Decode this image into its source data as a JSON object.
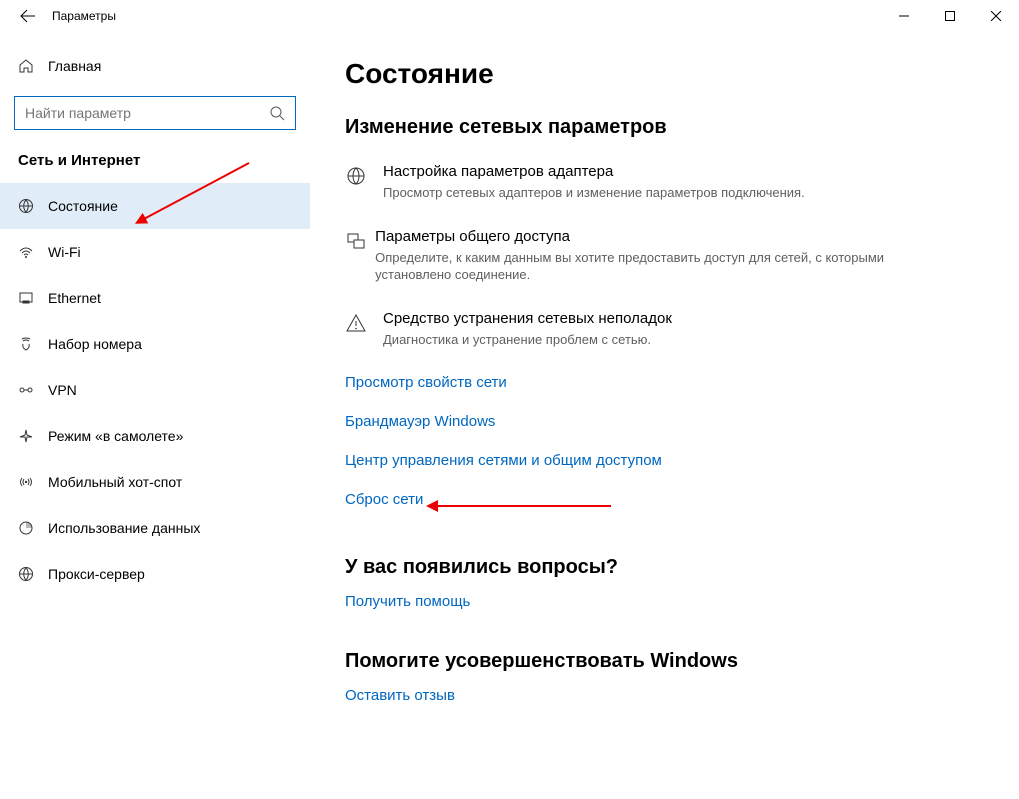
{
  "window": {
    "title": "Параметры"
  },
  "sidebar": {
    "home": "Главная",
    "search_placeholder": "Найти параметр",
    "section": "Сеть и Интернет",
    "items": [
      {
        "label": "Состояние"
      },
      {
        "label": "Wi-Fi"
      },
      {
        "label": "Ethernet"
      },
      {
        "label": "Набор номера"
      },
      {
        "label": "VPN"
      },
      {
        "label": "Режим «в самолете»"
      },
      {
        "label": "Мобильный хот-спот"
      },
      {
        "label": "Использование данных"
      },
      {
        "label": "Прокси-сервер"
      }
    ]
  },
  "main": {
    "title": "Состояние",
    "change_title": "Изменение сетевых параметров",
    "options": [
      {
        "title": "Настройка параметров адаптера",
        "desc": "Просмотр сетевых адаптеров и изменение параметров подключения."
      },
      {
        "title": "Параметры общего доступа",
        "desc": "Определите, к каким данным вы хотите предоставить доступ для сетей, с которыми установлено соединение."
      },
      {
        "title": "Средство устранения сетевых неполадок",
        "desc": "Диагностика и устранение проблем с сетью."
      }
    ],
    "links": [
      "Просмотр свойств сети",
      "Брандмауэр Windows",
      "Центр управления сетями и общим доступом",
      "Сброс сети"
    ],
    "questions_title": "У вас появились вопросы?",
    "get_help": "Получить помощь",
    "improve_title": "Помогите усовершенствовать Windows",
    "feedback": "Оставить отзыв"
  }
}
